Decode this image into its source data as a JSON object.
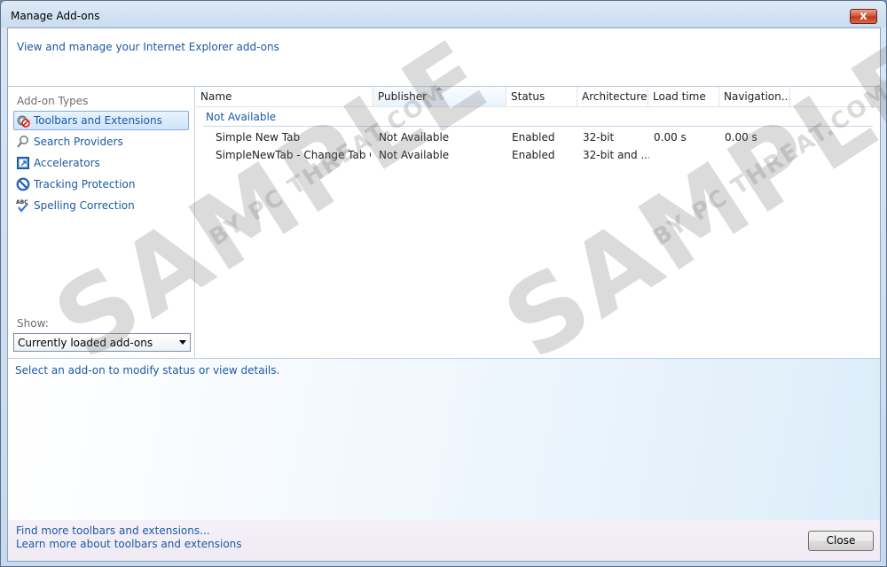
{
  "window": {
    "title": "Manage Add-ons",
    "close_glyph": "x"
  },
  "header": {
    "text": "View and manage your Internet Explorer add-ons"
  },
  "sidebar": {
    "types_label": "Add-on Types",
    "items": [
      {
        "label": "Toolbars and Extensions",
        "icon": "gear-no-icon",
        "selected": true
      },
      {
        "label": "Search Providers",
        "icon": "search-icon",
        "selected": false
      },
      {
        "label": "Accelerators",
        "icon": "accelerator-icon",
        "selected": false
      },
      {
        "label": "Tracking Protection",
        "icon": "tracking-protection-icon",
        "selected": false
      },
      {
        "label": "Spelling Correction",
        "icon": "spelling-check-icon",
        "selected": false
      }
    ],
    "show_label": "Show:",
    "show_value": "Currently loaded add-ons"
  },
  "list": {
    "columns": [
      "Name",
      "Publisher",
      "Status",
      "Architecture",
      "Load time",
      "Navigation..."
    ],
    "sorted_column": "Publisher",
    "group": "Not Available",
    "rows": [
      {
        "name": "Simple New Tab",
        "publisher": "Not Available",
        "status": "Enabled",
        "architecture": "32-bit",
        "load_time": "0.00 s",
        "navigation": "0.00 s"
      },
      {
        "name": "SimpleNewTab - Change Tab C...",
        "publisher": "Not Available",
        "status": "Enabled",
        "architecture": "32-bit and ...",
        "load_time": "",
        "navigation": ""
      }
    ]
  },
  "details": {
    "text": "Select an add-on to modify status or view details."
  },
  "footer": {
    "link1": "Find more toolbars and extensions...",
    "link2": "Learn more about toolbars and extensions",
    "close_label": "Close"
  },
  "watermark": {
    "big": "SAMPLE",
    "small": "BY PC THREAT.COM"
  },
  "colors": {
    "link": "#1a5aa6",
    "selection": "#cfe4fb",
    "title_close": "#c7432a"
  }
}
